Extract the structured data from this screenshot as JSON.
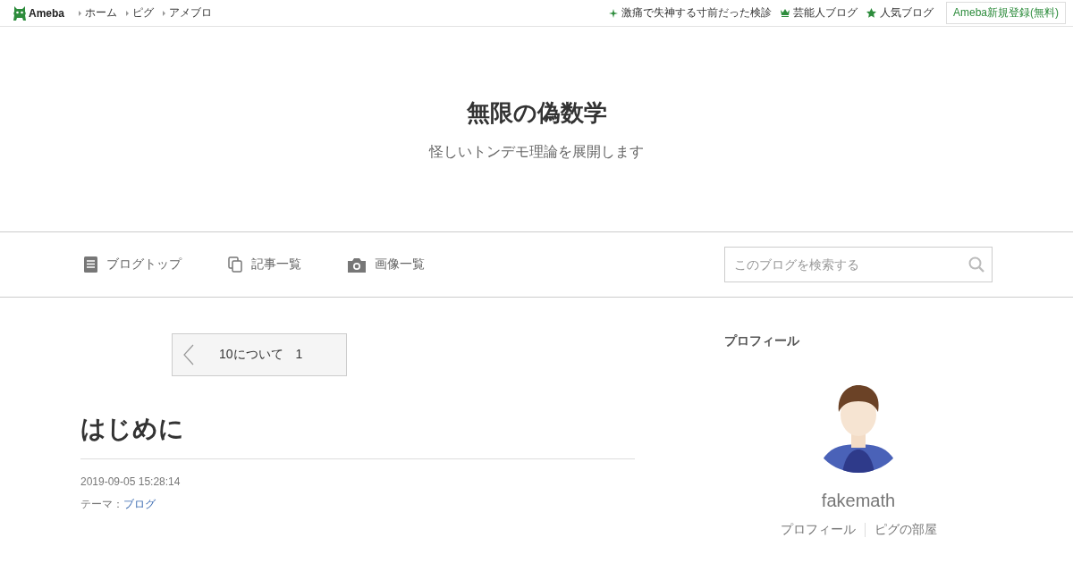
{
  "header": {
    "logo": "Ameba",
    "links": [
      {
        "label": "ホーム"
      },
      {
        "label": "ピグ"
      },
      {
        "label": "アメブロ"
      }
    ],
    "right_links": [
      {
        "kind": "sparkle",
        "label": "激痛で失神する寸前だった検診"
      },
      {
        "kind": "crown",
        "label": "芸能人ブログ"
      },
      {
        "kind": "star",
        "label": "人気ブログ"
      }
    ],
    "signup": "Ameba新規登録(無料)"
  },
  "blog": {
    "title": "無限の偽数学",
    "subtitle": "怪しいトンデモ理論を展開します"
  },
  "nav": {
    "items": [
      {
        "kind": "doc",
        "label": "ブログトップ"
      },
      {
        "kind": "copy",
        "label": "記事一覧"
      },
      {
        "kind": "camera",
        "label": "画像一覧"
      }
    ],
    "search": {
      "placeholder": "このブログを検索する"
    }
  },
  "pager": {
    "label": "10について　1"
  },
  "article": {
    "title": "はじめに",
    "date": "2019-09-05 15:28:14",
    "theme_label": "テーマ：",
    "theme": "ブログ"
  },
  "profile": {
    "heading": "プロフィール",
    "name": "fakemath",
    "links": [
      {
        "label": "プロフィール"
      },
      {
        "label": "ピグの部屋"
      }
    ]
  }
}
